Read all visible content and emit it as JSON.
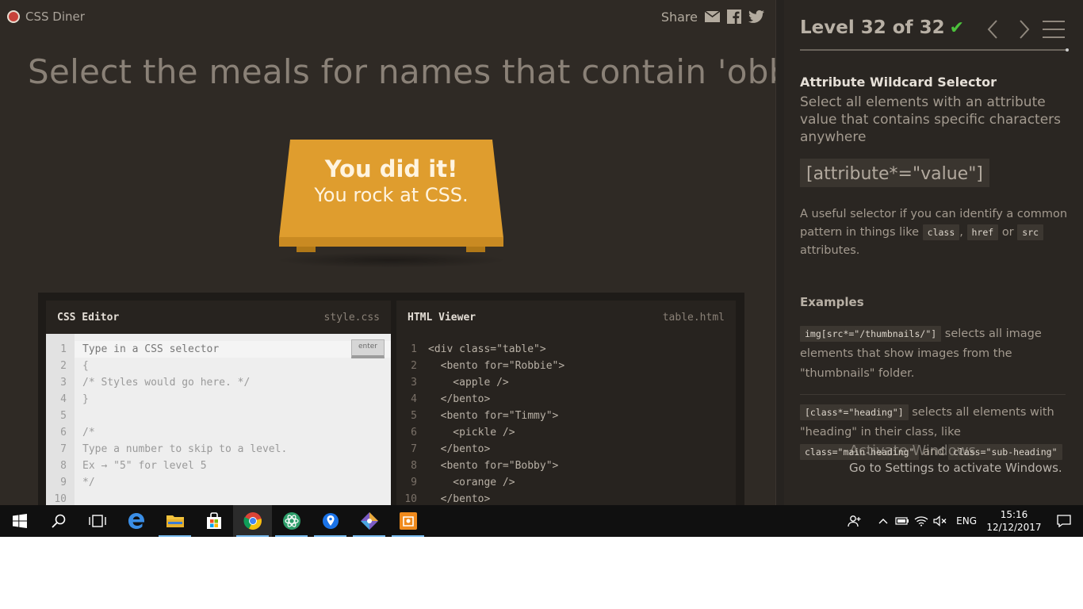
{
  "app": {
    "brand": "CSS Diner",
    "share_label": "Share",
    "order_text": "Select the meals for names that contain 'obb'"
  },
  "win": {
    "title": "You did it!",
    "subtitle": "You rock at CSS."
  },
  "css_editor": {
    "title": "CSS Editor",
    "file": "style.css",
    "enter_label": "enter",
    "line_numbers": [
      "1",
      "2",
      "3",
      "4",
      "5",
      "6",
      "7",
      "8",
      "9",
      "10"
    ],
    "lines": [
      "Type in a CSS selector",
      "{",
      "/* Styles would go here. */",
      "}",
      "",
      "/*",
      "Type a number to skip to a level.",
      "Ex → \"5\" for level 5",
      "*/",
      ""
    ]
  },
  "html_viewer": {
    "title": "HTML Viewer",
    "file": "table.html",
    "line_numbers": [
      "1",
      "2",
      "3",
      "4",
      "5",
      "6",
      "7",
      "8",
      "9",
      "10"
    ],
    "lines": [
      "<div class=\"table\">",
      "  <bento for=\"Robbie\">",
      "    <apple />",
      "  </bento>",
      "  <bento for=\"Timmy\">",
      "    <pickle />",
      "  </bento>",
      "  <bento for=\"Bobby\">",
      "    <orange />",
      "  </bento>"
    ]
  },
  "sidebar": {
    "level_label": "Level 32 of 32",
    "selector_name": "Attribute Wildcard Selector",
    "selector_title": "Select all elements with an attribute value that contains specific characters anywhere",
    "syntax": "[attribute*=\"value\"]",
    "hint_pre": "A useful selector if you can identify a common pattern in things like",
    "hint_tag1": "class",
    "hint_sep1": ",",
    "hint_tag2": "href",
    "hint_or": "or",
    "hint_tag3": "src",
    "hint_post": "attributes.",
    "examples_heading": "Examples",
    "ex1_code": "img[src*=\"/thumbnails/\"]",
    "ex1_text": "selects all image elements that show images from the \"thumbnails\" folder.",
    "ex2_code": "[class*=\"heading\"]",
    "ex2_text": "selects all elements with \"heading\" in their class, like",
    "ex2_tag1": "class=\"main-heading\"",
    "ex2_and": "and",
    "ex2_tag2": "class=\"sub-heading\""
  },
  "watermark": {
    "line1": "Activate Windows",
    "line2": "Go to Settings to activate Windows."
  },
  "taskbar": {
    "language": "ENG",
    "time": "15:16",
    "date": "12/12/2017",
    "pinned": [
      "windows-start",
      "search",
      "task-view",
      "edge",
      "file-explorer",
      "store",
      "chrome",
      "app-green",
      "maps",
      "git-app",
      "app-orange"
    ]
  },
  "colors": {
    "accent_check": "#4cc13c",
    "table": "#d99a2c",
    "background": "#2f2a25"
  }
}
